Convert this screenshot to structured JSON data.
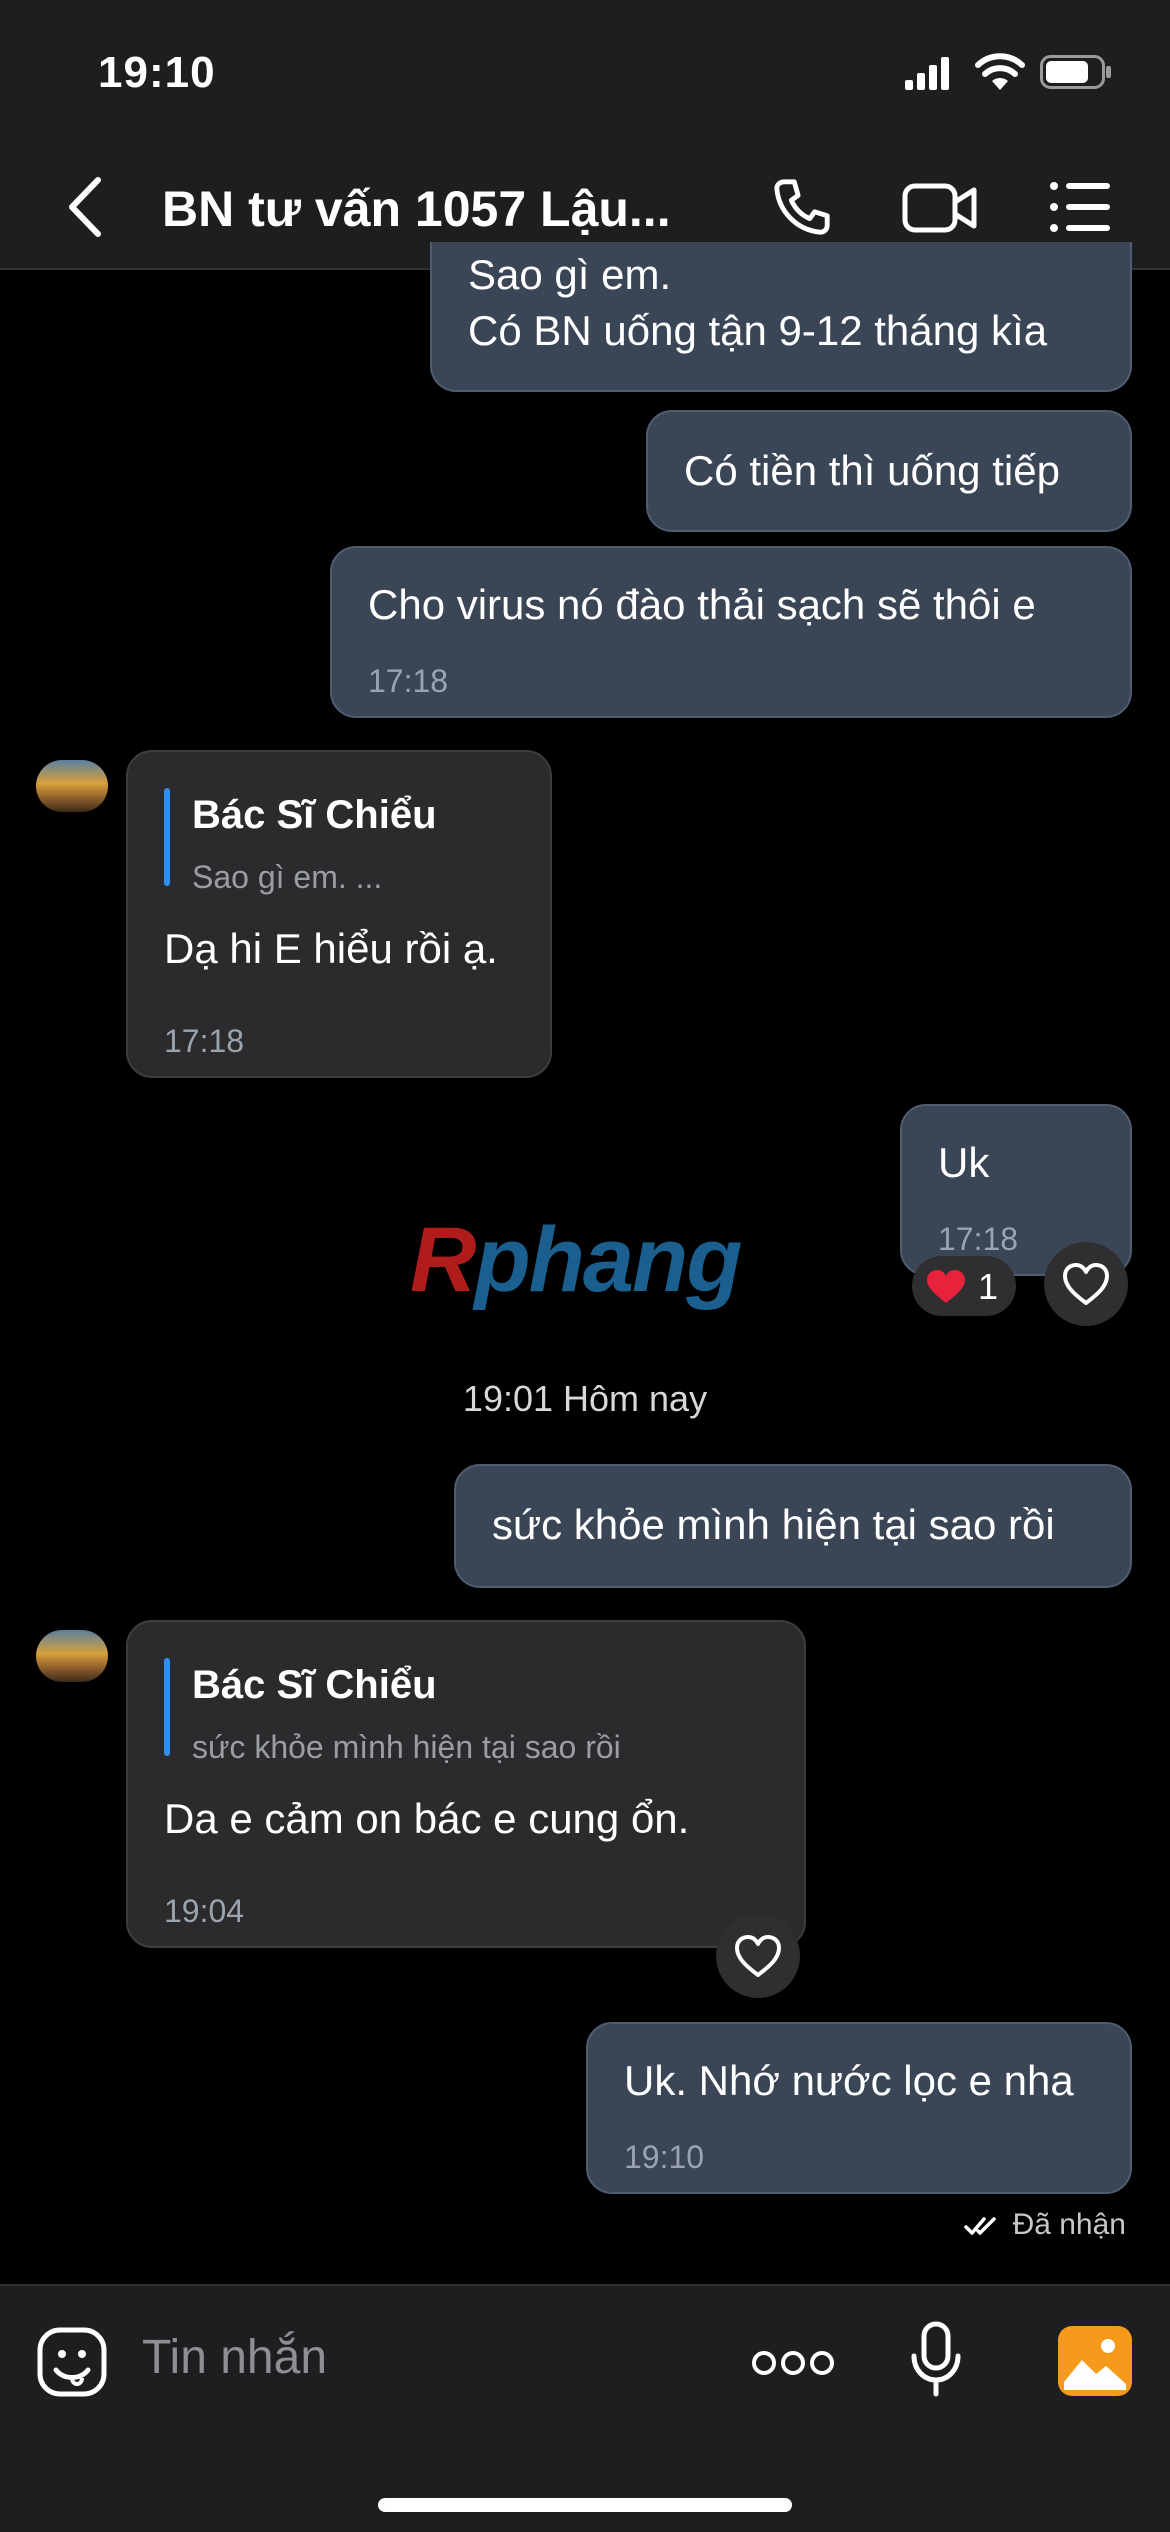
{
  "status_bar": {
    "time": "19:10"
  },
  "header": {
    "title": "BN tư vấn 1057 Lậu..."
  },
  "messages": [
    {
      "text_line1": "Sao gì em.",
      "text_line2": "Có BN uống tận 9-12 tháng kìa"
    },
    {
      "text": "Có tiền thì uống tiếp"
    },
    {
      "text": "Cho virus nó đào thải sạch sẽ thôi e",
      "time": "17:18"
    },
    {
      "quote_name": "Bác Sĩ Chiểu",
      "quote_text": "Sao gì em. ...",
      "text": "Dạ hi E hiểu rồi ạ.",
      "time": "17:18"
    },
    {
      "text": "Uk",
      "time": "17:18",
      "reaction_count": "1"
    },
    {
      "text": "sức khỏe mình hiện tại sao rồi"
    },
    {
      "quote_name": "Bác Sĩ Chiểu",
      "quote_text": "sức khỏe mình hiện tại sao rồi",
      "text": "Da  e  cảm on bác  e cung ổn.",
      "time": "19:04"
    },
    {
      "text": "Uk. Nhớ nước lọc e nha",
      "time": "19:10"
    }
  ],
  "watermark": {
    "part1": "R",
    "part2": "phang"
  },
  "date_separator": "19:01 Hôm nay",
  "delivery_status": "Đã nhận",
  "composer": {
    "placeholder": "Tin nhắn"
  },
  "colors": {
    "my_bubble": "#3a4556",
    "their_bubble": "#2b2b2e",
    "quote_bar": "#2f8ff0",
    "heart": "#e8223a",
    "gallery_icon": "#f59a1b"
  }
}
